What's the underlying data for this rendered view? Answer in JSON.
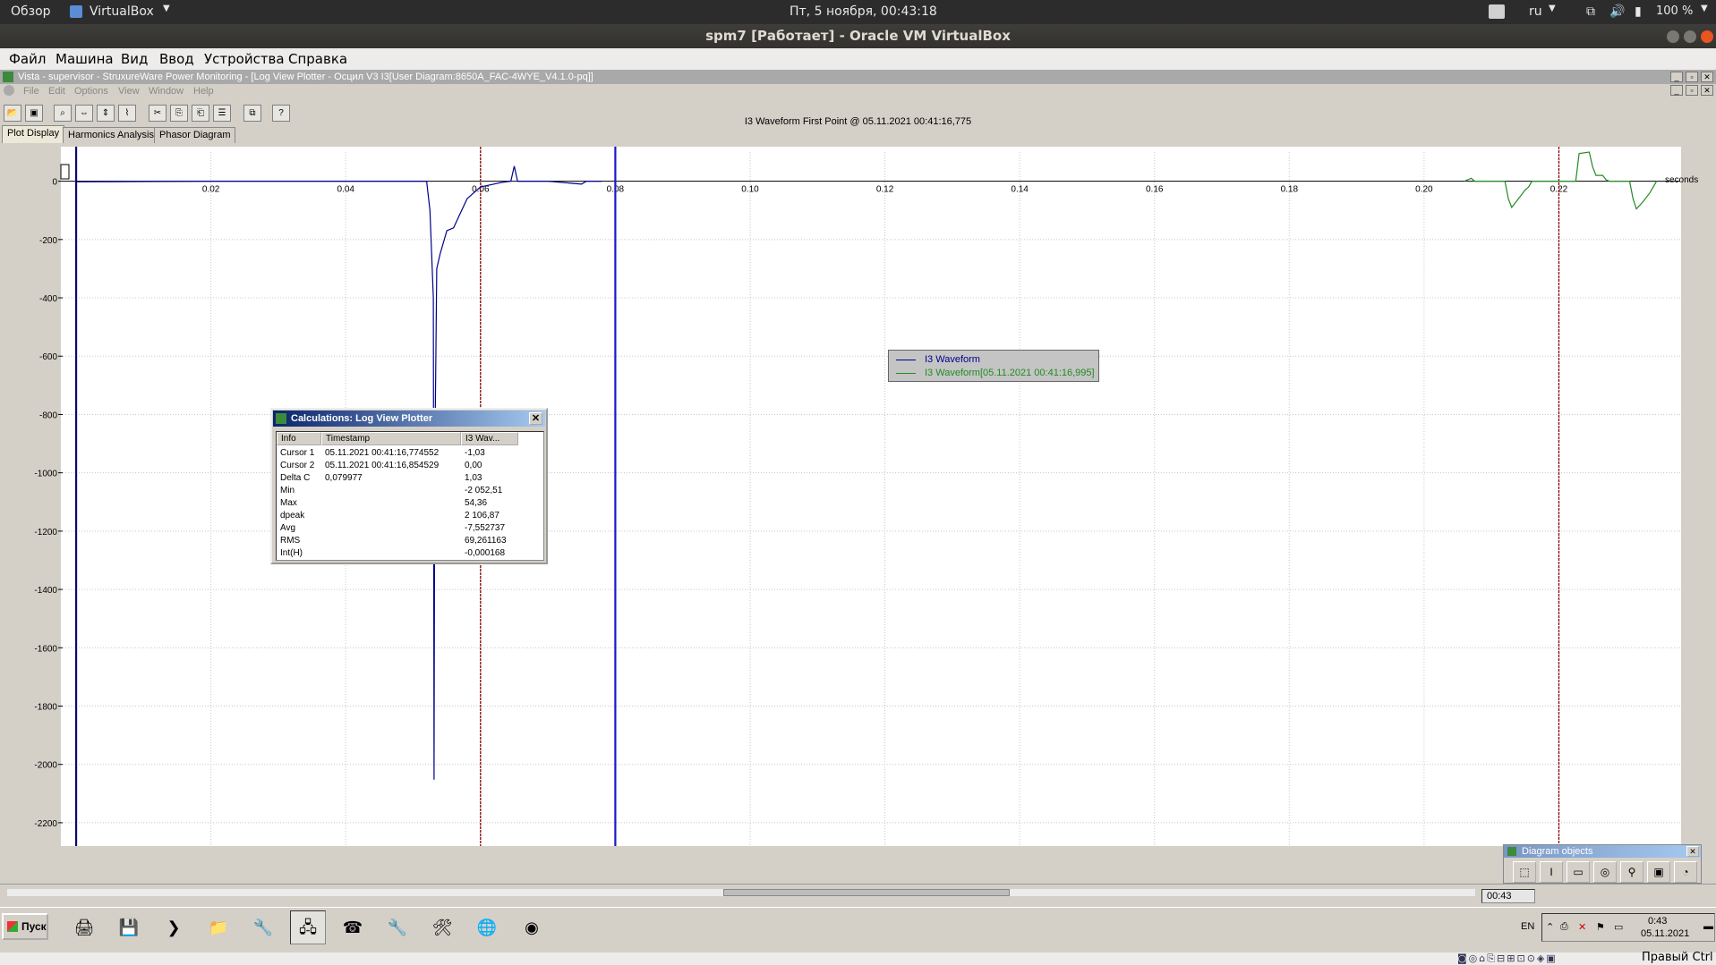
{
  "host": {
    "overview": "Обзор",
    "app_name": "VirtualBox",
    "clock": "Пт, 5 ноября, 00:43:18",
    "lang": "ru",
    "battery": "100 %",
    "window_title": "spm7 [Работает] - Oracle VM VirtualBox",
    "menu": [
      "Файл",
      "Машина",
      "Вид",
      "Ввод",
      "Устройства",
      "Справка"
    ],
    "host_key": "Правый Ctrl"
  },
  "app": {
    "title": "Vista - supervisor - StruxureWare Power Monitoring - [Log View Plotter - Осцил V3 I3[User Diagram:8650A_FAC-4WYE_V4.1.0-pq]]",
    "menu": [
      "File",
      "Edit",
      "Options",
      "View",
      "Window",
      "Help"
    ],
    "tabs": [
      "Plot Display",
      "Harmonics Analysis",
      "Phasor Diagram"
    ],
    "plot_header": "I3 Waveform First Point @ 05.11.2021 00:41:16,775",
    "status_time": "00:43"
  },
  "chart_data": {
    "type": "line",
    "xlabel": "seconds",
    "xlim": [
      -0.002,
      0.238
    ],
    "ylim": [
      -2280,
      100
    ],
    "x_ticks": [
      "0.02",
      "0.04",
      "0.06",
      "0.08",
      "0.10",
      "0.12",
      "0.14",
      "0.16",
      "0.18",
      "0.20",
      "0.22"
    ],
    "y_ticks": [
      "0",
      "-200",
      "-400",
      "-600",
      "-800",
      "-1000",
      "-1200",
      "-1400",
      "-1600",
      "-1800",
      "-2000",
      "-2200"
    ],
    "cursors": [
      {
        "x": 0.0,
        "color": "#0a0a6a"
      },
      {
        "x": 0.06,
        "color": "#8b0000"
      },
      {
        "x": 0.08,
        "color": "#1a1ac8"
      },
      {
        "x": 0.22,
        "color": "#8b0000"
      }
    ],
    "series": [
      {
        "name": "I3 Waveform",
        "color": "#00008b",
        "x": [
          0.0,
          0.02,
          0.045,
          0.052,
          0.0525,
          0.053,
          0.0531,
          0.0532,
          0.0535,
          0.054,
          0.055,
          0.056,
          0.057,
          0.058,
          0.059,
          0.06,
          0.063,
          0.0645,
          0.065,
          0.0655,
          0.066,
          0.07,
          0.075,
          0.0757,
          0.078
        ],
        "y": [
          -2,
          0,
          0,
          0,
          -100,
          -400,
          -2052,
          -1000,
          -300,
          -250,
          -170,
          -160,
          -110,
          -60,
          -40,
          -20,
          -5,
          0,
          52,
          0,
          0,
          0,
          -10,
          0,
          0
        ]
      },
      {
        "name": "I3 Waveform[05.11.2021 00:41:16,995]",
        "color": "#228b22",
        "x": [
          0.206,
          0.207,
          0.2075,
          0.212,
          0.2125,
          0.213,
          0.214,
          0.215,
          0.2155,
          0.216,
          0.2165,
          0.2205,
          0.2225,
          0.223,
          0.2245,
          0.225,
          0.2255,
          0.2265,
          0.227,
          0.2275,
          0.2305,
          0.231,
          0.2315,
          0.2325,
          0.2335,
          0.234,
          0.2345
        ],
        "y": [
          0,
          10,
          0,
          0,
          -60,
          -90,
          -60,
          -30,
          -20,
          0,
          0,
          0,
          0,
          95,
          100,
          50,
          20,
          20,
          5,
          0,
          0,
          -60,
          -95,
          -70,
          -40,
          -20,
          0
        ]
      }
    ],
    "legend": [
      "I3 Waveform",
      "I3 Waveform[05.11.2021 00:41:16,995]"
    ]
  },
  "calc": {
    "title": "Calculations: Log View Plotter",
    "headers": [
      "Info",
      "Timestamp",
      "I3 Wav..."
    ],
    "rows": [
      [
        "Cursor 1",
        "05.11.2021 00:41:16,774552",
        "-1,03"
      ],
      [
        "Cursor 2",
        "05.11.2021 00:41:16,854529",
        "0,00"
      ],
      [
        "Delta C",
        "0,079977",
        "1,03"
      ],
      [
        "Min",
        "",
        "-2 052,51"
      ],
      [
        "Max",
        "",
        "54,36"
      ],
      [
        "dpeak",
        "",
        "2 106,87"
      ],
      [
        "Avg",
        "",
        "-7,552737"
      ],
      [
        "RMS",
        "",
        "69,261163"
      ],
      [
        "Int(H)",
        "",
        "-0,000168"
      ]
    ]
  },
  "diagram_objects": {
    "title": "Diagram objects"
  },
  "taskbar": {
    "start": "Пуск",
    "lang": "EN",
    "time": "0:43",
    "date": "05.11.2021"
  }
}
